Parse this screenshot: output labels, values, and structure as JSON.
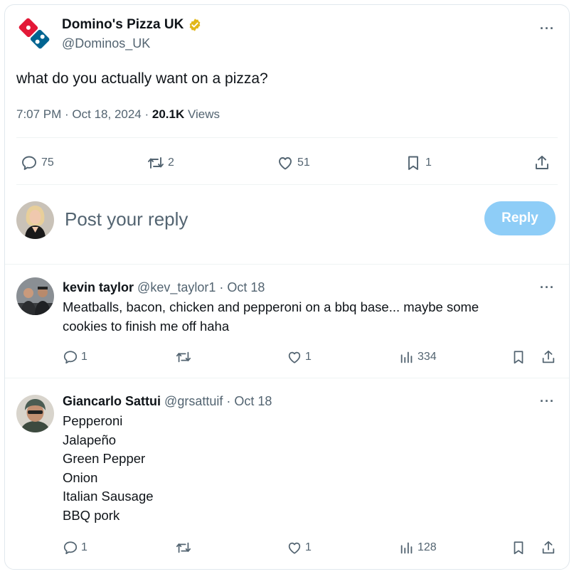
{
  "tweet": {
    "author_name": "Domino's Pizza UK",
    "author_handle": "@Dominos_UK",
    "more": "···",
    "text": "what do you actually want on a pizza?",
    "time_date": "7:07 PM · Oct 18, 2024 · ",
    "views_count": "20.1K",
    "views_label": " Views",
    "actions": {
      "replies": "75",
      "reposts": "2",
      "likes": "51",
      "bookmarks": "1"
    }
  },
  "composer": {
    "placeholder": "Post your reply",
    "reply_label": "Reply"
  },
  "replies": [
    {
      "name": "kevin taylor",
      "meta": " @kev_taylor1 · Oct 18",
      "more": "···",
      "text_lines": [
        "Meatballs, bacon, chicken and pepperoni on a bbq base... maybe some",
        "cookies to finish me off haha"
      ],
      "replies": "1",
      "likes": "1",
      "views": "334"
    },
    {
      "name": "Giancarlo Sattui",
      "meta": " @grsattuif · Oct 18",
      "more": "···",
      "text_lines": [
        "Pepperoni",
        "Jalapeño",
        "Green Pepper",
        "Onion",
        "Italian Sausage",
        "BBQ pork"
      ],
      "replies": "1",
      "likes": "1",
      "views": "128"
    }
  ],
  "colors": {
    "brand_blue": "#006491",
    "brand_red": "#e31837",
    "reply_button": "#8ecdf7",
    "secondary_text": "#536471",
    "verified_gold": "#e2b719"
  },
  "icons": [
    "dominos-logo-icon",
    "verified-badge-icon",
    "more-icon",
    "reply-icon",
    "repost-icon",
    "like-icon",
    "bookmark-icon",
    "share-icon",
    "views-icon"
  ]
}
